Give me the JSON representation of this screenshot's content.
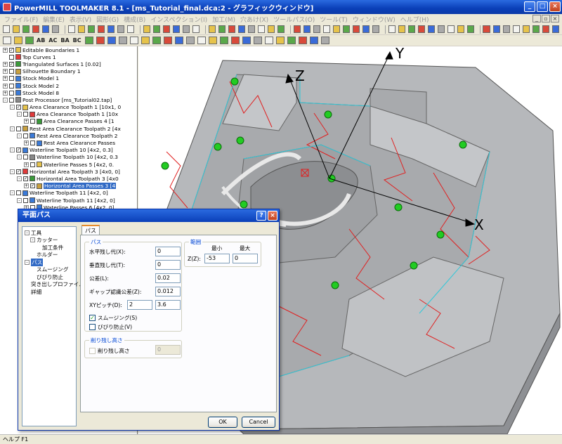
{
  "window": {
    "title": "PowerMILL TOOLMAKER 8.1 - [ms_Tutorial_final.dca:2 - グラフィックウィンドウ]",
    "buttons": [
      "_",
      "□",
      "×"
    ]
  },
  "menubar": {
    "items": [
      "ファイル(F)",
      "編集(E)",
      "表示(V)",
      "図形(G)",
      "構成(B)",
      "インスペクション(I)",
      "加工(M)",
      "穴あけ(X)",
      "ツールパス(O)",
      "ツール(T)",
      "ウィンドウ(W)",
      "ヘルプ(H)"
    ]
  },
  "toolbar2": {
    "text_items": [
      "AB",
      "AC",
      "BA",
      "BC"
    ]
  },
  "tree": {
    "rows": [
      {
        "indent": 0,
        "exp": "+",
        "chk": "✓",
        "label": "Editable Boundaries 1"
      },
      {
        "indent": 0,
        "exp": "",
        "chk": "",
        "label": "Top Curves 1"
      },
      {
        "indent": 0,
        "exp": "+",
        "chk": "✓",
        "label": "Triangulated Surfaces 1 [0.02]"
      },
      {
        "indent": 0,
        "exp": "+",
        "chk": "",
        "label": "Silhouette Boundary 1"
      },
      {
        "indent": 0,
        "exp": "+",
        "chk": "",
        "label": "Stock Model 1"
      },
      {
        "indent": 0,
        "exp": "+",
        "chk": "",
        "label": "Stock Model 2"
      },
      {
        "indent": 0,
        "exp": "+",
        "chk": "",
        "label": "Stock Model 8"
      },
      {
        "indent": 0,
        "exp": "-",
        "chk": "",
        "label": "Post Processor [ms_Tutorial02.tap]"
      },
      {
        "indent": 1,
        "exp": "-",
        "chk": "✓",
        "label": "Area Clearance Toolpath 1 [10x1, 0"
      },
      {
        "indent": 2,
        "exp": "-",
        "chk": "",
        "label": "Area Clearance Toolpath 1 [10x"
      },
      {
        "indent": 3,
        "exp": "+",
        "chk": "",
        "label": "Area Clearance Passes 4 [1"
      },
      {
        "indent": 1,
        "exp": "-",
        "chk": "",
        "label": "Rest Area Clearance Toolpath 2 [4x"
      },
      {
        "indent": 2,
        "exp": "-",
        "chk": "",
        "label": "Rest Area Clearance Toolpath 2"
      },
      {
        "indent": 3,
        "exp": "+",
        "chk": "",
        "label": "Rest Area Clearance Passes"
      },
      {
        "indent": 1,
        "exp": "-",
        "chk": "✓",
        "label": "Waterline Toolpath 10 [4x2, 0.3]"
      },
      {
        "indent": 2,
        "exp": "-",
        "chk": "",
        "label": "Waterline Toolpath 10 [4x2, 0.3"
      },
      {
        "indent": 3,
        "exp": "+",
        "chk": "",
        "label": "Waterline Passes 5 [4x2, 0."
      },
      {
        "indent": 1,
        "exp": "-",
        "chk": "✓",
        "label": "Horizontal Area Toolpath 3 [4x0, 0]"
      },
      {
        "indent": 2,
        "exp": "-",
        "chk": "✓",
        "label": "Horizontal Area Toolpath 3 [4x0"
      },
      {
        "indent": 3,
        "exp": "+",
        "chk": "✓",
        "label": "Horizontal Area Passes 3 [4",
        "selected": true
      },
      {
        "indent": 1,
        "exp": "-",
        "chk": "",
        "label": "Waterline Toolpath 11 [4x2, 0]"
      },
      {
        "indent": 2,
        "exp": "-",
        "chk": "",
        "label": "Waterline Toolpath 11 [4x2, 0]"
      },
      {
        "indent": 3,
        "exp": "+",
        "chk": "",
        "label": "Waterline Passes 6 [4x2, 0]"
      }
    ]
  },
  "viewport": {
    "axis_labels": {
      "x": "X",
      "y": "Y",
      "z": "Z"
    }
  },
  "dialog": {
    "title": "平面パス",
    "help_btn": "?",
    "close_btn": "×",
    "tree": [
      {
        "indent": 0,
        "exp": "-",
        "label": "工具"
      },
      {
        "indent": 1,
        "exp": "-",
        "label": "カッター"
      },
      {
        "indent": 2,
        "exp": "",
        "label": "加工条件"
      },
      {
        "indent": 1,
        "exp": "",
        "label": "ホルダー"
      },
      {
        "indent": 0,
        "exp": "-",
        "label": "パス",
        "selected": true
      },
      {
        "indent": 1,
        "exp": "",
        "label": "スムージング"
      },
      {
        "indent": 1,
        "exp": "",
        "label": "びびり防止"
      },
      {
        "indent": 0,
        "exp": "",
        "label": "突き出しプロファイル"
      },
      {
        "indent": 0,
        "exp": "",
        "label": "詳細"
      }
    ],
    "tab_label": "パス",
    "pass_group": {
      "title": "パス",
      "fields": [
        {
          "label": "水平残し代(X):",
          "value": "0"
        },
        {
          "label": "垂直残し代(T):",
          "value": "0"
        },
        {
          "label": "公差(L):",
          "value": "0.02"
        },
        {
          "label": "ギャップ認識公差(Z):",
          "value": "0.012"
        }
      ],
      "xy_pitch": {
        "label": "XYピッチ(D):",
        "value1": "2",
        "value2": "3.6"
      },
      "smoothing": {
        "label": "スムージング(S)",
        "checked": true
      },
      "chatter": {
        "label": "びびり防止(V)",
        "checked": false
      }
    },
    "range_group": {
      "title": "範囲",
      "min_label": "最小",
      "max_label": "最大",
      "z_label": "Z(Z):",
      "z_min": "-53",
      "z_max": "0"
    },
    "cut_group": {
      "title": "削り残し高さ",
      "check_label": "削り残し高さ",
      "value": "0"
    },
    "ok_label": "OK",
    "cancel_label": "Cancel"
  },
  "statusbar": {
    "text": "ヘルプ F1"
  }
}
